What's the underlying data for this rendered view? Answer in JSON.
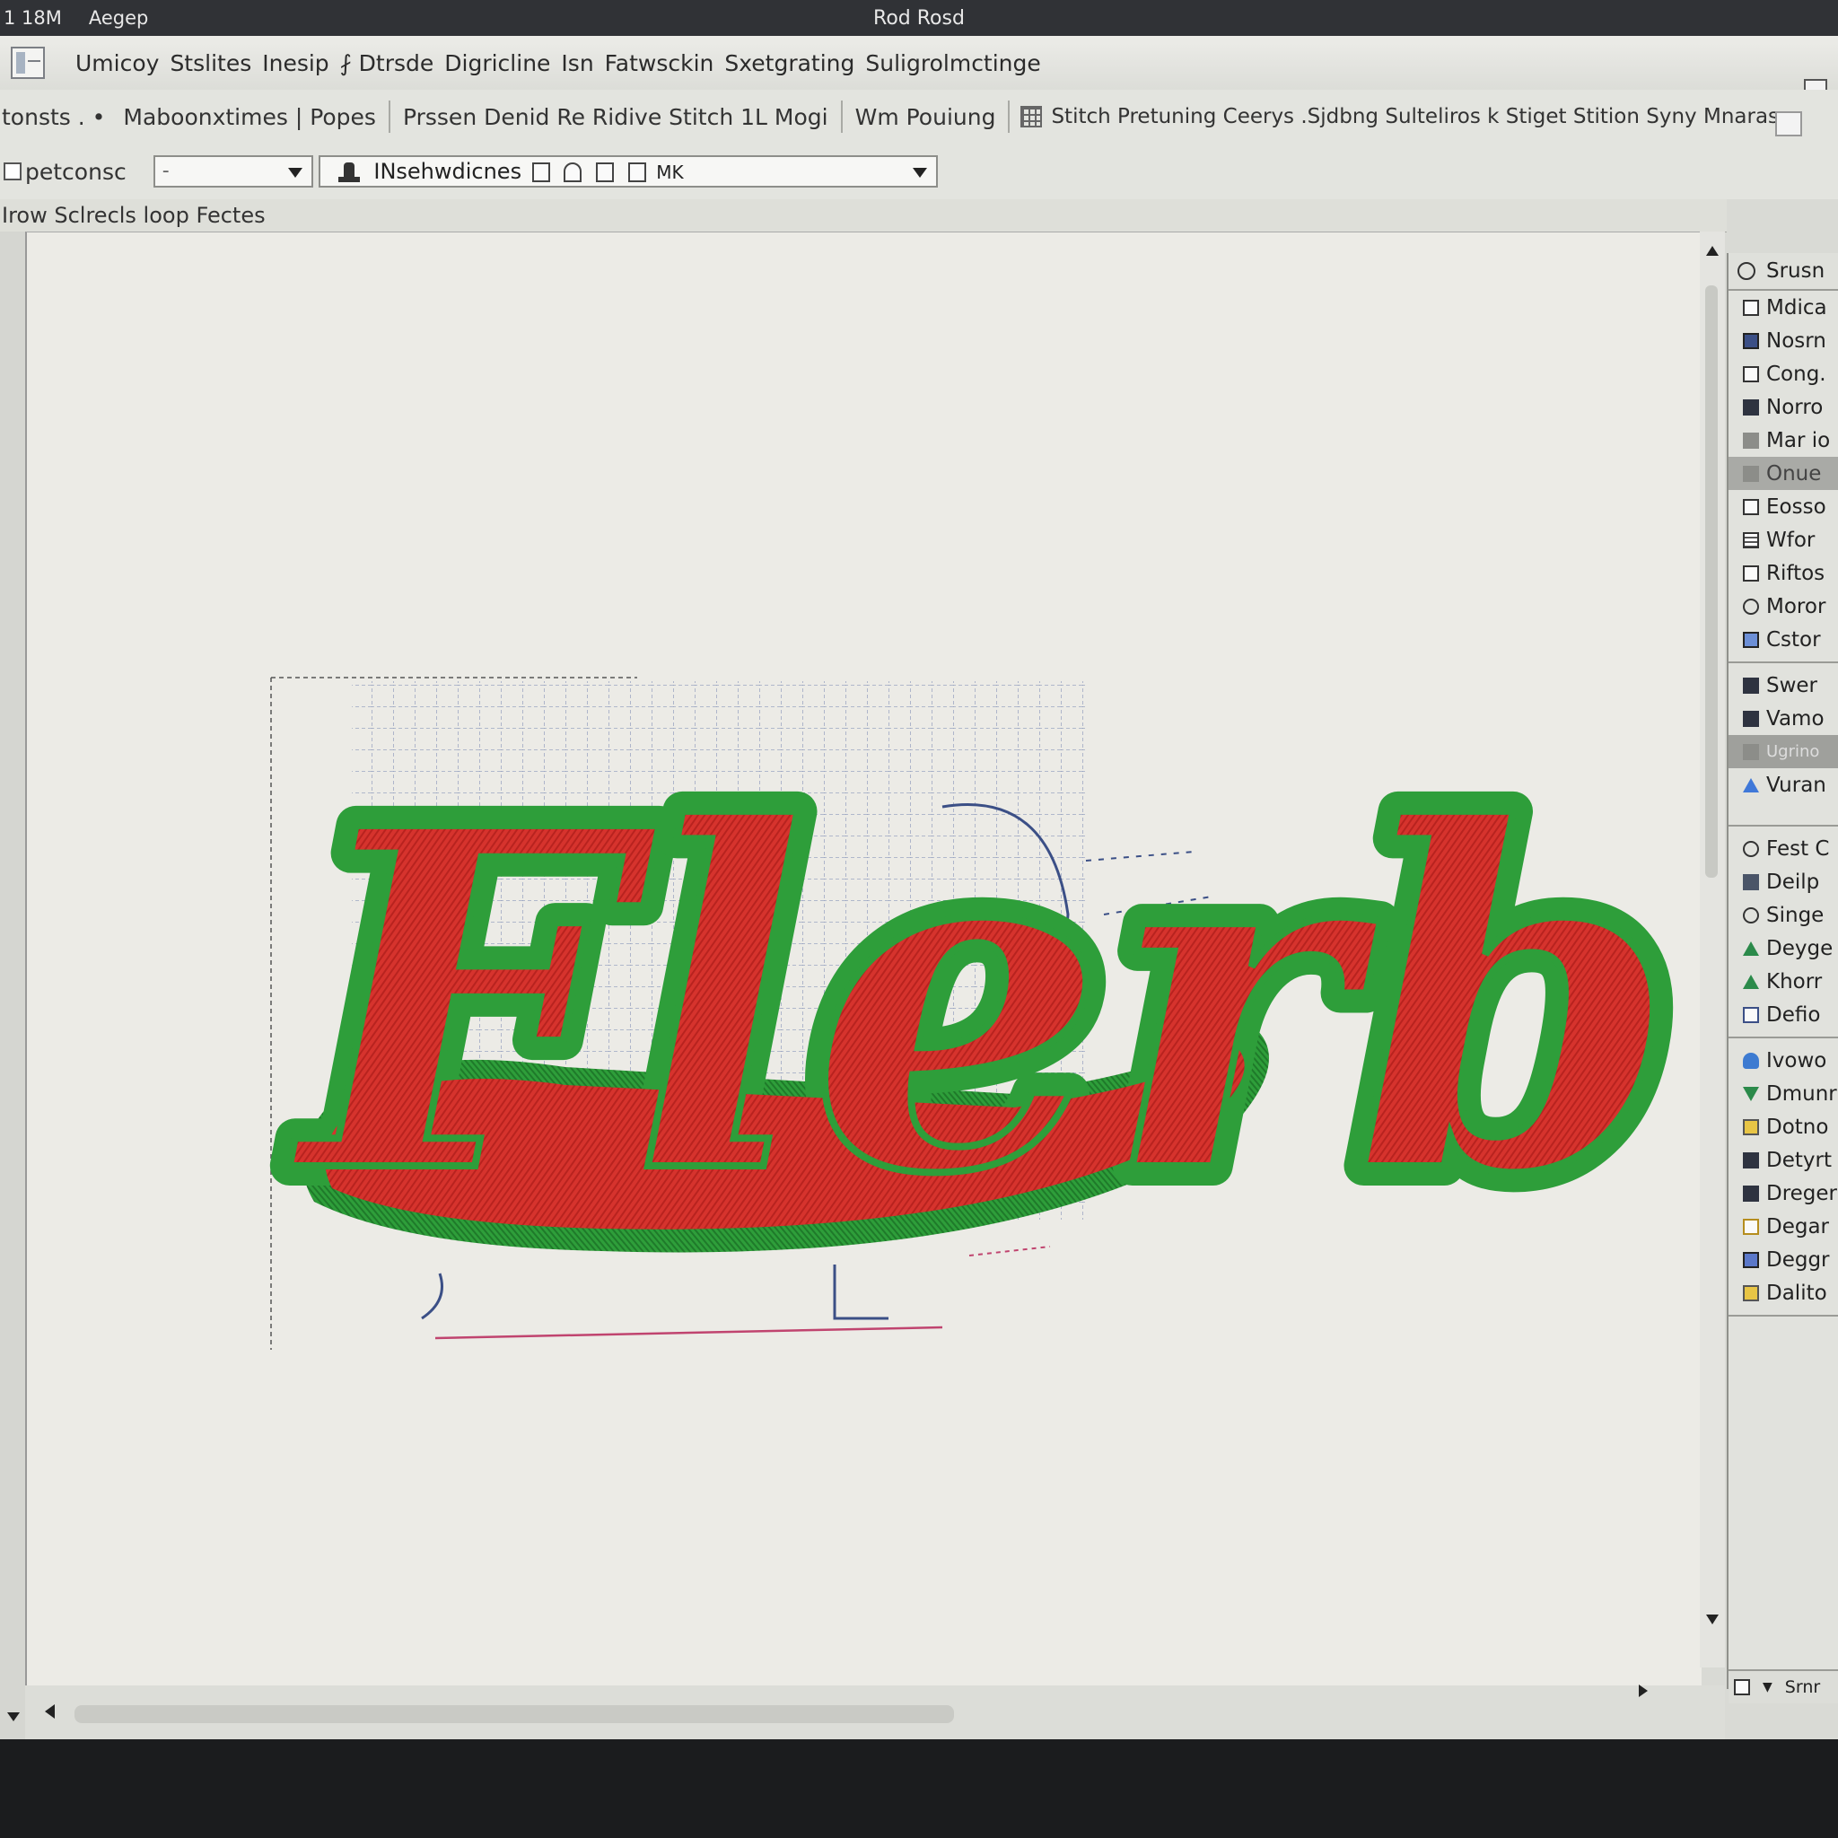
{
  "system_bar": {
    "left_items": [
      "1 18M",
      "Aegep"
    ],
    "window_title": "Rod Rosd"
  },
  "menubar": {
    "items": [
      "Umicoy",
      "Stslites",
      "Inesip",
      "⨏ Dtrsde",
      "Digricline",
      "Isn",
      "Fatwsckin",
      "Sxetgrating",
      "Suligrolmctinge"
    ]
  },
  "toolbar1": {
    "items": [
      "tonsts . •",
      "Maboonxtimes | Popes",
      "Prssen Denid Re Ridive Stitch 1L Mogi",
      "Wm Pouiung",
      "Stitch Pretuning Ceerys .Sjdbng Sulteliros k Stiget Stition Syny Mnaras"
    ]
  },
  "toolbar2": {
    "checkbox_label": "petconsc",
    "dropdown1_value": "-",
    "dropdown2_label": "INsehwdicnes",
    "dropdown2_suffix": "MK"
  },
  "status_strip": {
    "text": "Irow Sclrecls loop Fectes"
  },
  "design": {
    "word": "Flerb",
    "fill_color": "#d6332d",
    "outline_color": "#2e9e3a",
    "grid_color": "#6a7fb0"
  },
  "right_panel": {
    "header": "Srusn",
    "group1": [
      {
        "label": "Mdica",
        "icon": "box-icon"
      },
      {
        "label": "Nosrn",
        "icon": "filled-square-icon"
      },
      {
        "label": "Cong.",
        "icon": "box-icon"
      },
      {
        "label": "Norro",
        "icon": "dark-square-icon"
      },
      {
        "label": "Mar io",
        "icon": "bucket-icon"
      },
      {
        "label": "Onue",
        "icon": "bucket-icon",
        "selected": true
      },
      {
        "label": "Eosso",
        "icon": "box-icon"
      },
      {
        "label": "Wfor",
        "icon": "gallery-icon"
      },
      {
        "label": "Riftos",
        "icon": "lines-icon"
      },
      {
        "label": "Moror",
        "icon": "circle-icon"
      },
      {
        "label": "Cstor",
        "icon": "blue-badge-icon"
      }
    ],
    "group2": [
      {
        "label": "Swer",
        "icon": "dark-square-icon"
      },
      {
        "label": "Vamo",
        "icon": "dark-square-icon"
      },
      {
        "label": "Ugrino",
        "icon": "bucket-icon",
        "selected": true
      },
      {
        "label": "Vuran",
        "icon": "arrow-up-icon"
      }
    ],
    "group3_header": "Fest C",
    "group3": [
      {
        "label": "Deilp",
        "icon": "dark-square-icon"
      },
      {
        "label": "Singe",
        "icon": "circle-icon"
      },
      {
        "label": "Deyge",
        "icon": "triangle-icon"
      },
      {
        "label": "Khorr",
        "icon": "triangle-icon"
      },
      {
        "label": "Defio",
        "icon": "box-icon"
      }
    ],
    "group4": [
      {
        "label": "Ivowo",
        "icon": "blue-drop-icon"
      },
      {
        "label": "Dmunr",
        "icon": "funnel-icon"
      },
      {
        "label": "Dotno",
        "icon": "yellow-icon"
      },
      {
        "label": "Detyrt",
        "icon": "dark-square-icon"
      },
      {
        "label": "Dreger",
        "icon": "dark-square-icon"
      },
      {
        "label": "Degar",
        "icon": "shapes-icon"
      },
      {
        "label": "Deggr",
        "icon": "filled-square-icon"
      },
      {
        "label": "Dalito",
        "icon": "yellow-icon"
      }
    ],
    "footer": "Srnr"
  }
}
